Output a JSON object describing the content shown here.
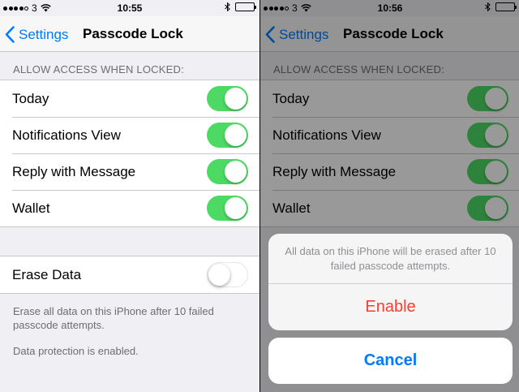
{
  "colors": {
    "accent": "#007aff",
    "switch_on": "#4cd964",
    "destructive": "#ff3b30"
  },
  "left": {
    "status": {
      "carrier": "3",
      "time": "10:55",
      "signal_bars": 4,
      "battery_level": 1.0
    },
    "nav": {
      "back_label": "Settings",
      "title": "Passcode Lock"
    },
    "section_header": "ALLOW ACCESS WHEN LOCKED:",
    "access_items": [
      {
        "label": "Today",
        "on": true
      },
      {
        "label": "Notifications View",
        "on": true
      },
      {
        "label": "Reply with Message",
        "on": true
      },
      {
        "label": "Wallet",
        "on": true
      }
    ],
    "erase": {
      "label": "Erase Data",
      "on": false
    },
    "footnote_erase": "Erase all data on this iPhone after 10 failed passcode attempts.",
    "footnote_protection": "Data protection is enabled."
  },
  "right": {
    "status": {
      "carrier": "3",
      "time": "10:56",
      "signal_bars": 4,
      "battery_level": 1.0
    },
    "nav": {
      "back_label": "Settings",
      "title": "Passcode Lock"
    },
    "section_header": "ALLOW ACCESS WHEN LOCKED:",
    "access_items": [
      {
        "label": "Today",
        "on": true
      },
      {
        "label": "Notifications View",
        "on": true
      },
      {
        "label": "Reply with Message",
        "on": true
      },
      {
        "label": "Wallet",
        "on": true
      }
    ],
    "action_sheet": {
      "message": "All data on this iPhone will be erased after 10 failed passcode attempts.",
      "confirm_label": "Enable",
      "cancel_label": "Cancel"
    }
  },
  "icons": {
    "back": "chevron-left-icon",
    "wifi": "wifi-icon",
    "bluetooth": "bluetooth-icon",
    "battery": "battery-icon"
  }
}
